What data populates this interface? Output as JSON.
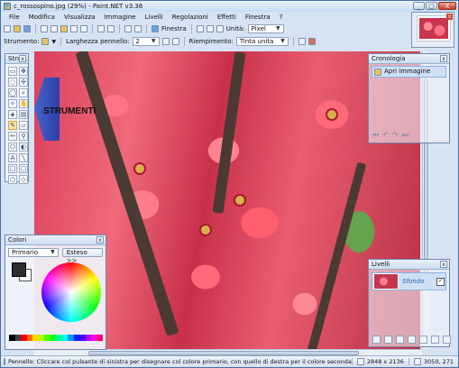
{
  "window": {
    "title": "c_rossospino.jpg (29%) - Paint.NET v3.36",
    "controls": [
      "_",
      "□",
      "X"
    ]
  },
  "menu": [
    "File",
    "Modifica",
    "Visualizza",
    "Immagine",
    "Livelli",
    "Regolazioni",
    "Effetti",
    "Finestra",
    "?"
  ],
  "toolbar1": {
    "finestra_label": "Finestra",
    "unita_label": "Unità:",
    "unita_value": "Pixel"
  },
  "toolbar2": {
    "strumento_label": "Strumento:",
    "larghezza_label": "Larghezza pennello:",
    "larghezza_value": "2",
    "riempimento_label": "Riempimento:",
    "riempimento_value": "Tinta unita"
  },
  "panels": {
    "tools_title": "Stru...",
    "history_title": "Cronologia",
    "history_items": [
      "Apri immagine"
    ],
    "colors_title": "Colori",
    "colors_mode": "Primario",
    "colors_button": "Esteso >>",
    "layers_title": "Livelli",
    "layer_name": "Sfondo"
  },
  "annotation": "STRUMENTI",
  "statusbar": {
    "message": "Pennello: Cliccare col pulsante di sinistra per disegnare col colore primario, con quello di destra per il colore secondario",
    "size": "2848 x 2136",
    "coords": "3050, 271"
  },
  "colors": {
    "primary": "#2d2d2d",
    "secondary": "#ffffff",
    "accent": "#6f88ad"
  }
}
